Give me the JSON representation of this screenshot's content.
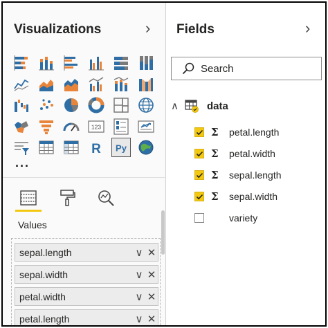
{
  "visualizations": {
    "title": "Visualizations",
    "collapse_glyph": "›",
    "more_label": "...",
    "icons": [
      "stacked-bar-chart-icon",
      "stacked-column-chart-icon",
      "clustered-bar-chart-icon",
      "clustered-column-chart-icon",
      "100-stacked-bar-chart-icon",
      "100-stacked-column-chart-icon",
      "line-chart-icon",
      "area-chart-icon",
      "stacked-area-chart-icon",
      "line-clustered-column-chart-icon",
      "line-stacked-column-chart-icon",
      "ribbon-chart-icon",
      "waterfall-chart-icon",
      "scatter-chart-icon",
      "pie-chart-icon",
      "donut-chart-icon",
      "treemap-icon",
      "map-icon",
      "filled-map-icon",
      "funnel-chart-icon",
      "gauge-icon",
      "card-icon",
      "multi-row-card-icon",
      "kpi-icon",
      "slicer-icon",
      "table-icon",
      "matrix-icon",
      "r-script-visual-icon",
      "python-visual-icon",
      "arcgis-map-icon"
    ],
    "r_glyph": "R",
    "py_glyph": "Py",
    "card_glyph": "123",
    "values_label": "Values",
    "values": [
      {
        "label": "sepal.length"
      },
      {
        "label": "sepal.width"
      },
      {
        "label": "petal.width"
      },
      {
        "label": "petal.length"
      }
    ],
    "dropdown_glyph": "∨",
    "remove_glyph": "✕"
  },
  "fields": {
    "title": "Fields",
    "collapse_glyph": "›",
    "search_placeholder": "Search",
    "table": {
      "name": "data",
      "expand_glyph": "∧"
    },
    "sigma_glyph": "Σ",
    "items": [
      {
        "name": "petal.length",
        "checked": true,
        "numeric": true
      },
      {
        "name": "petal.width",
        "checked": true,
        "numeric": true
      },
      {
        "name": "sepal.length",
        "checked": true,
        "numeric": true
      },
      {
        "name": "sepal.width",
        "checked": true,
        "numeric": true
      },
      {
        "name": "variety",
        "checked": false,
        "numeric": false
      }
    ]
  },
  "colors": {
    "accent": "#f2c811",
    "blue": "#2f6ea5",
    "orange": "#e8853a",
    "gray": "#7a7a7a"
  }
}
